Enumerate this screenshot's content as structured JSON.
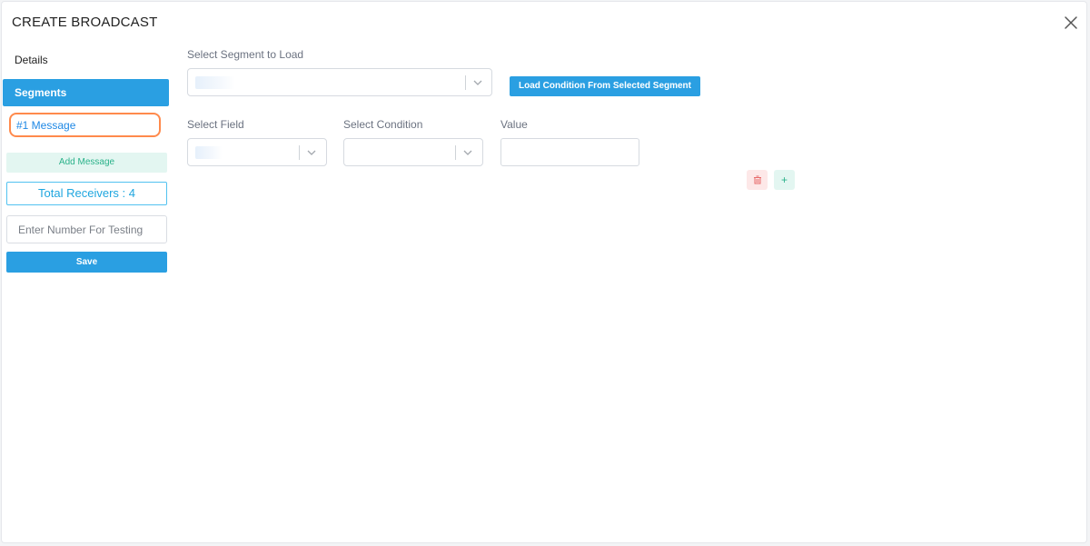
{
  "dialog": {
    "title": "CREATE BROADCAST",
    "close_icon": "close-icon"
  },
  "sidebar": {
    "details_label": "Details",
    "segments_label": "Segments",
    "message_label": "#1 Message",
    "add_message_label": "Add Message",
    "total_receivers_label": "Total Receivers : 4",
    "test_number_placeholder": "Enter Number For Testing",
    "save_label": "Save"
  },
  "main": {
    "segment_select_label": "Select Segment to Load",
    "load_button_label": "Load Condition From Selected Segment",
    "field_label": "Select Field",
    "condition_label": "Select Condition",
    "value_label": "Value",
    "delete_icon": "trash-icon",
    "add_icon": "plus-icon",
    "add_glyph": "+"
  },
  "colors": {
    "primary": "#2a9fe2",
    "active_outline": "#ff8a4c",
    "success_tint": "#e3f6f1",
    "danger": "#e86a6a"
  }
}
